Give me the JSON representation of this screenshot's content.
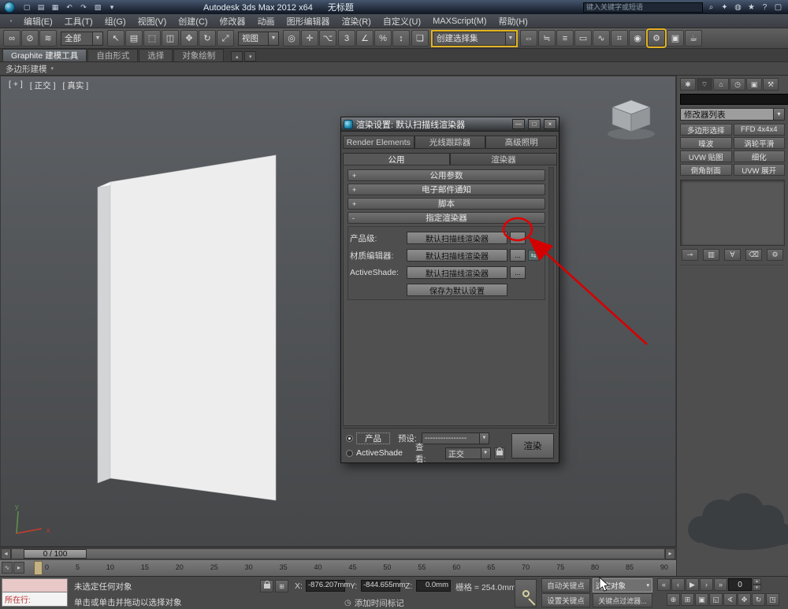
{
  "glyphs": {
    "dropdown": "▼",
    "small_down": "▾",
    "small_up": "▴",
    "left": "◂",
    "right": "▸",
    "dots": "⋮"
  },
  "titlebar": {
    "title": "Autodesk 3ds Max  2012 x64",
    "doc_title": "无标题",
    "search_placeholder": "键入关键字或短语",
    "quick_icons": [
      {
        "name": "new-scene-icon",
        "glyph": "▢"
      },
      {
        "name": "open-file-icon",
        "glyph": "▤"
      },
      {
        "name": "save-file-icon",
        "glyph": "▦"
      },
      {
        "name": "undo-icon",
        "glyph": "↶"
      },
      {
        "name": "redo-icon",
        "glyph": "↷"
      },
      {
        "name": "project-folder-icon",
        "glyph": "▧"
      },
      {
        "name": "workspace-dropdown-icon",
        "glyph": "▾"
      }
    ],
    "info_icons": [
      {
        "name": "search-icon",
        "glyph": "⌕"
      },
      {
        "name": "subscription-center-icon",
        "glyph": "✦"
      },
      {
        "name": "communication-center-icon",
        "glyph": "◍"
      },
      {
        "name": "favorites-icon",
        "glyph": "★"
      },
      {
        "name": "help-icon",
        "glyph": "?"
      },
      {
        "name": "app-window-icon",
        "glyph": "▢"
      }
    ]
  },
  "menu": {
    "grip": "▪",
    "items": [
      "编辑(E)",
      "工具(T)",
      "组(G)",
      "视图(V)",
      "创建(C)",
      "修改器",
      "动画",
      "图形编辑器",
      "渲染(R)",
      "自定义(U)",
      "MAXScript(M)",
      "帮助(H)"
    ]
  },
  "toolbar": {
    "selection_filter_value": "全部",
    "coord_system_value": "视图",
    "named_sets_value": "创建选择集",
    "render_setup_glyph": "⚙",
    "group_link": [
      {
        "name": "select-and-link-icon",
        "glyph": "∞"
      },
      {
        "name": "unlink-selection-icon",
        "glyph": "⊘"
      },
      {
        "name": "bind-to-space-warp-icon",
        "glyph": "≋"
      }
    ],
    "group_select": [
      {
        "name": "select-object-icon",
        "glyph": "↖"
      },
      {
        "name": "select-by-name-icon",
        "glyph": "▤"
      },
      {
        "name": "rectangular-selection-region-icon",
        "glyph": "⬚"
      },
      {
        "name": "window-crossing-icon",
        "glyph": "◫"
      }
    ],
    "group_transform": [
      {
        "name": "select-and-move-icon",
        "glyph": "✥"
      },
      {
        "name": "select-and-rotate-icon",
        "glyph": "↻"
      },
      {
        "name": "select-and-scale-icon",
        "glyph": "⤢"
      }
    ],
    "group_pivot": [
      {
        "name": "use-pivot-point-center-icon",
        "glyph": "◎"
      },
      {
        "name": "select-and-manipulate-icon",
        "glyph": "✛"
      },
      {
        "name": "keyboard-shortcut-override-icon",
        "glyph": "⌥"
      }
    ],
    "group_snap": [
      {
        "name": "snaps-toggle-icon",
        "glyph": "3"
      },
      {
        "name": "angle-snap-icon",
        "glyph": "∠"
      },
      {
        "name": "percent-snap-icon",
        "glyph": "%"
      },
      {
        "name": "spinner-snap-icon",
        "glyph": "↕"
      }
    ],
    "edit_named_sets": {
      "name": "edit-named-selection-sets-icon",
      "glyph": "❏"
    },
    "group_tools": [
      {
        "name": "mirror-icon",
        "glyph": "⇔"
      },
      {
        "name": "align-icon",
        "glyph": "≒"
      },
      {
        "name": "layer-manager-icon",
        "glyph": "≡"
      },
      {
        "name": "graphite-ribbon-toggle-icon",
        "glyph": "▭"
      },
      {
        "name": "curve-editor-icon",
        "glyph": "∿"
      },
      {
        "name": "schematic-view-icon",
        "glyph": "⌗"
      },
      {
        "name": "material-editor-icon",
        "glyph": "◉"
      }
    ],
    "group_render": [
      {
        "name": "rendered-frame-window-icon",
        "glyph": "▣"
      },
      {
        "name": "render-production-icon",
        "glyph": "☕"
      }
    ]
  },
  "ribbon": {
    "tabs": [
      "Graphite 建模工具",
      "自由形式",
      "选择",
      "对象绘制"
    ],
    "collapse_glyph": "▴",
    "flyout_glyph": "▾",
    "subtab": "多边形建模"
  },
  "viewport": {
    "menu_label": "[ + ]",
    "view_label": "[ 正交 ]",
    "shading_label": "[ 真实 ]",
    "axis_x": "x",
    "axis_y": "y"
  },
  "render_dialog": {
    "title": "渲染设置: 默认扫描线渲染器",
    "window_buttons": [
      {
        "name": "minimize-button",
        "glyph": "—"
      },
      {
        "name": "maximize-button",
        "glyph": "□"
      },
      {
        "name": "close-button",
        "glyph": "×"
      }
    ],
    "tabs_top": [
      "Render Elements",
      "光线跟踪器",
      "高级照明"
    ],
    "tabs_bottom": [
      "公用",
      "渲染器"
    ],
    "rollouts_collapsed": [
      {
        "sign": "+",
        "label": "公用参数"
      },
      {
        "sign": "+",
        "label": "电子邮件通知"
      },
      {
        "sign": "+",
        "label": "脚本"
      }
    ],
    "assign": {
      "sign": "-",
      "title": "指定渲染器",
      "browse": "...",
      "rows": [
        {
          "label": "产品级:",
          "value": "默认扫描线渲染器"
        },
        {
          "label": "材质编辑器:",
          "value": "默认扫描线渲染器"
        },
        {
          "label": "ActiveShade:",
          "value": "默认扫描线渲染器"
        }
      ],
      "lock_glyph": "⇆",
      "save_defaults": "保存为默认设置"
    },
    "footer": {
      "product": "产品",
      "activeshade": "ActiveShade",
      "preset_label": "预设:",
      "preset_value": "----------------",
      "view_label": "查看:",
      "view_value": "正交",
      "render": "渲染"
    }
  },
  "command_panel": {
    "tabs": [
      {
        "name": "create-tab",
        "glyph": "✱"
      },
      {
        "name": "modify-tab",
        "glyph": "⌔"
      },
      {
        "name": "hierarchy-tab",
        "glyph": "⌂"
      },
      {
        "name": "motion-tab",
        "glyph": "◷"
      },
      {
        "name": "display-tab",
        "glyph": "▣"
      },
      {
        "name": "utilities-tab",
        "glyph": "⚒"
      }
    ],
    "modifier_list_label": "修改器列表",
    "modifier_buttons": [
      "多边形选择",
      "FFD 4x4x4",
      "噪波",
      "涡轮平滑",
      "UVW 贴图",
      "细化",
      "倒角剖面",
      "UVW 展开"
    ],
    "stack_icons": [
      {
        "name": "pin-stack-icon",
        "glyph": "⊸"
      },
      {
        "name": "show-end-result-icon",
        "glyph": "▥"
      },
      {
        "name": "make-unique-icon",
        "glyph": "∀"
      },
      {
        "name": "remove-modifier-icon",
        "glyph": "⌫"
      },
      {
        "name": "configure-modifier-sets-icon",
        "glyph": "⚙"
      }
    ]
  },
  "timeline": {
    "frame_display": "0 / 100"
  },
  "trackbar": {
    "left_icons": [
      {
        "name": "open-mini-curve-editor-button",
        "glyph": "∿"
      },
      {
        "name": "trackbar-options-button",
        "glyph": "▸"
      }
    ],
    "ticks": [
      "0",
      "5",
      "10",
      "15",
      "20",
      "25",
      "30",
      "35",
      "40",
      "45",
      "50",
      "55",
      "60",
      "65",
      "70",
      "75",
      "80",
      "85",
      "90"
    ]
  },
  "statusbar": {
    "listener_label": "所在行:",
    "status_line": "未选定任何对象",
    "prompt_line": "单击或单击并拖动以选择对象",
    "x_label": "X:",
    "x_value": "-876.207mm",
    "y_label": "Y:",
    "y_value": "-844.655mm",
    "z_label": "Z:",
    "z_value": "0.0mm",
    "grid_text": "栅格 = 254.0mm",
    "auto_key": "自动关键点",
    "set_key": "设置关键点",
    "selected_filter": "选定对象",
    "key_filters": "关键点过滤器...",
    "add_time_tag": "添加时间标记",
    "time_tag_glyph": "◷",
    "frame_field": "0",
    "playback_icons": [
      {
        "name": "go-to-start-button",
        "glyph": "«"
      },
      {
        "name": "previous-frame-button",
        "glyph": "‹"
      },
      {
        "name": "play-animation-button",
        "glyph": "▶"
      },
      {
        "name": "next-frame-button",
        "glyph": "›"
      },
      {
        "name": "go-to-end-button",
        "glyph": "»"
      }
    ],
    "nav_icons": [
      {
        "name": "zoom-button",
        "glyph": "⊕"
      },
      {
        "name": "zoom-all-button",
        "glyph": "⊞"
      },
      {
        "name": "zoom-extents-button",
        "glyph": "▣"
      },
      {
        "name": "zoom-extents-all-button",
        "glyph": "◱"
      },
      {
        "name": "field-of-view-button",
        "glyph": "∢"
      },
      {
        "name": "pan-view-button",
        "glyph": "✥"
      },
      {
        "name": "orbit-button",
        "glyph": "↻"
      },
      {
        "name": "maximize-viewport-toggle-button",
        "glyph": "◳"
      }
    ]
  }
}
